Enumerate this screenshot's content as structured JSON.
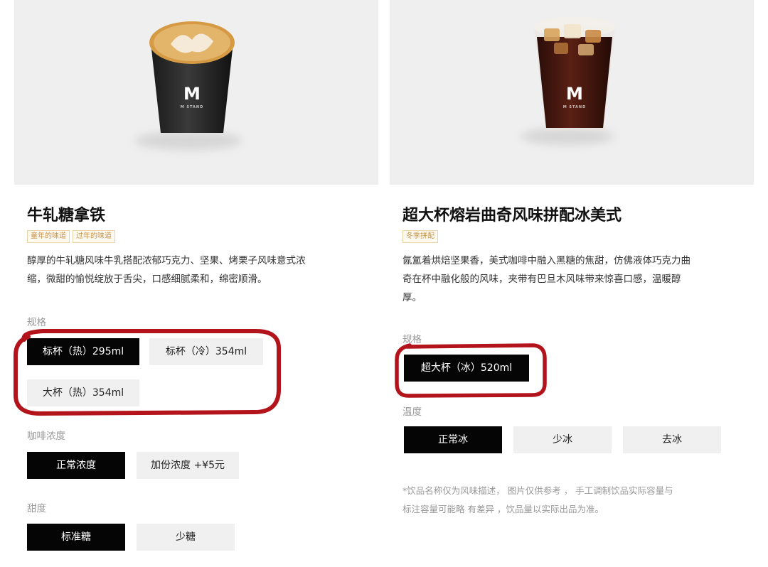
{
  "products": [
    {
      "name": "牛轧糖拿铁",
      "tags": [
        "童年的味道",
        "过年的味道"
      ],
      "description": [
        "醇厚的牛轧糖风味牛乳搭配浓郁巧克力、坚果、烤栗子风味意式浓",
        "缩，微甜的愉悦绽放于舌尖，口感细腻柔和，绵密顺滑。"
      ],
      "cup_logo": "M",
      "sections": [
        {
          "label": "规格",
          "options": [
            {
              "text": "标杯（热）295ml",
              "selected": true
            },
            {
              "text": "标杯（冷）354ml",
              "selected": false
            },
            {
              "text": "大杯（热）354ml",
              "selected": false
            }
          ]
        },
        {
          "label": "咖啡浓度",
          "options": [
            {
              "text": "正常浓度",
              "selected": true
            },
            {
              "text": "加份浓度 +¥5元",
              "selected": false
            }
          ]
        },
        {
          "label": "甜度",
          "options": [
            {
              "text": "标准糖",
              "selected": true
            },
            {
              "text": "少糖",
              "selected": false
            }
          ]
        }
      ]
    },
    {
      "name": "超大杯熔岩曲奇风味拼配冰美式",
      "tags": [
        "冬季拼配"
      ],
      "description": [
        "氤氲着烘焙坚果香，美式咖啡中融入黑糖的焦甜，仿佛液体巧克力曲",
        "奇在杯中融化般的风味，夹带有巴旦木风味带来惊喜口感，温暖醇",
        "厚。"
      ],
      "cup_logo": "M",
      "sections": [
        {
          "label": "规格",
          "options": [
            {
              "text": "超大杯（冰）520ml",
              "selected": true
            }
          ]
        },
        {
          "label": "温度",
          "options": [
            {
              "text": "正常冰",
              "selected": true
            },
            {
              "text": "少冰",
              "selected": false
            },
            {
              "text": "去冰",
              "selected": false
            }
          ]
        }
      ],
      "note": [
        "*饮品名称仅为风味描述， 图片仅供参考 ， 手工调制饮品实际容量与",
        "标注容量可能略 有差异 ，饮品量以实际出品为准。"
      ]
    }
  ],
  "colors": {
    "selected_bg": "#050505",
    "unselected_bg": "#f0f0f0",
    "annotation_ring": "#b3141b",
    "tag": "#c49248"
  }
}
